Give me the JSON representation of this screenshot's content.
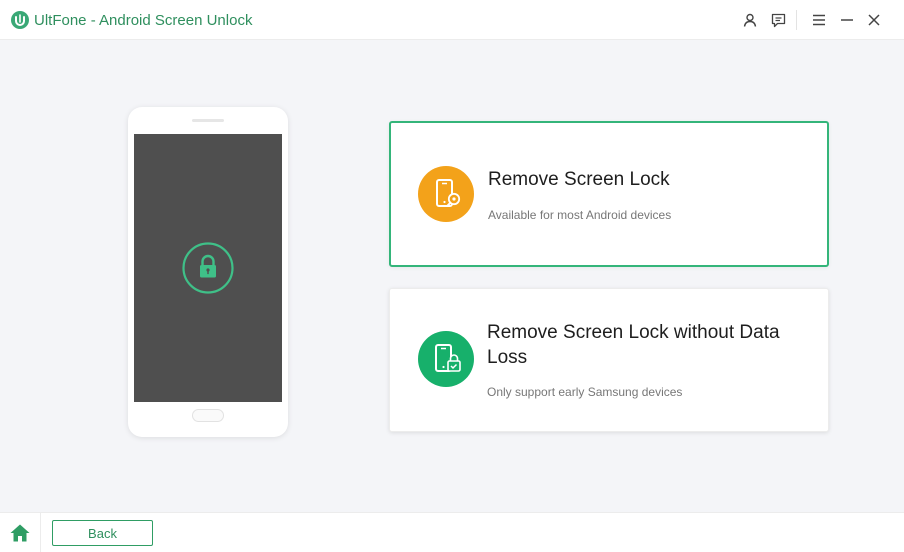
{
  "window": {
    "title": "UltFone - Android Screen Unlock",
    "logo_icon": "ultfone-logo-icon",
    "controls": [
      {
        "name": "account-icon"
      },
      {
        "name": "feedback-icon"
      },
      {
        "name": "menu-icon"
      },
      {
        "name": "minimize-icon"
      },
      {
        "name": "close-icon"
      }
    ]
  },
  "phone_illustration": {
    "icon": "padlock-icon"
  },
  "options": [
    {
      "title": "Remove Screen Lock",
      "subtitle": "Available for most Android devices",
      "icon": "phone-key-icon",
      "icon_color": "#f3a21a",
      "selected": true
    },
    {
      "title": "Remove Screen Lock without Data Loss",
      "subtitle": "Only support early Samsung devices",
      "icon": "phone-lock-icon",
      "icon_color": "#17b06b",
      "selected": false
    }
  ],
  "footer": {
    "home_icon": "home-icon",
    "back_label": "Back"
  },
  "colors": {
    "accent": "#2f8f5e",
    "selected_border": "#34b57a",
    "background": "#f4f5f8"
  }
}
